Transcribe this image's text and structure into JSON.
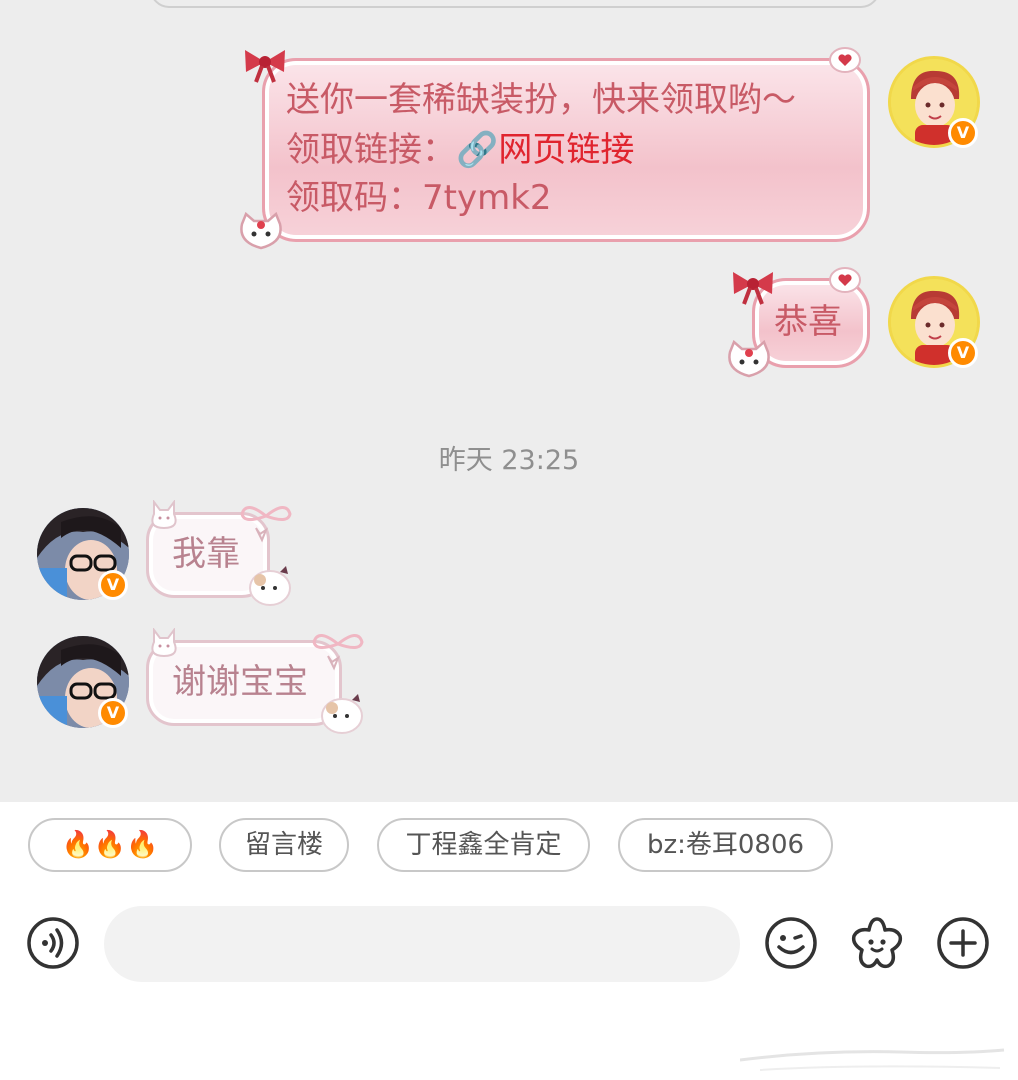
{
  "messages": {
    "gift": {
      "line1": "送你一套稀缺装扮，快来领取哟～",
      "line2_label": "领取链接：",
      "link_icon": "🔗",
      "link_text": "网页链接",
      "line3": "领取码：7tymk2"
    },
    "congrats": "恭喜",
    "timestamp": "昨天 23:25",
    "reply1": "我靠",
    "reply2": "谢谢宝宝"
  },
  "badges": {
    "verified": "V"
  },
  "chips": [
    "🔥🔥🔥",
    "留言楼",
    "丁程鑫全肯定",
    "bz:卷耳0806"
  ],
  "input": {
    "placeholder": ""
  },
  "icons": {
    "voice": "voice-icon",
    "emoji": "emoji-icon",
    "sticker": "sticker-icon",
    "add": "add-icon"
  },
  "colors": {
    "accent_pink": "#e9a0ad",
    "link_red": "#e0242e",
    "badge_orange": "#ff8a00",
    "chat_bg": "#ededed"
  }
}
